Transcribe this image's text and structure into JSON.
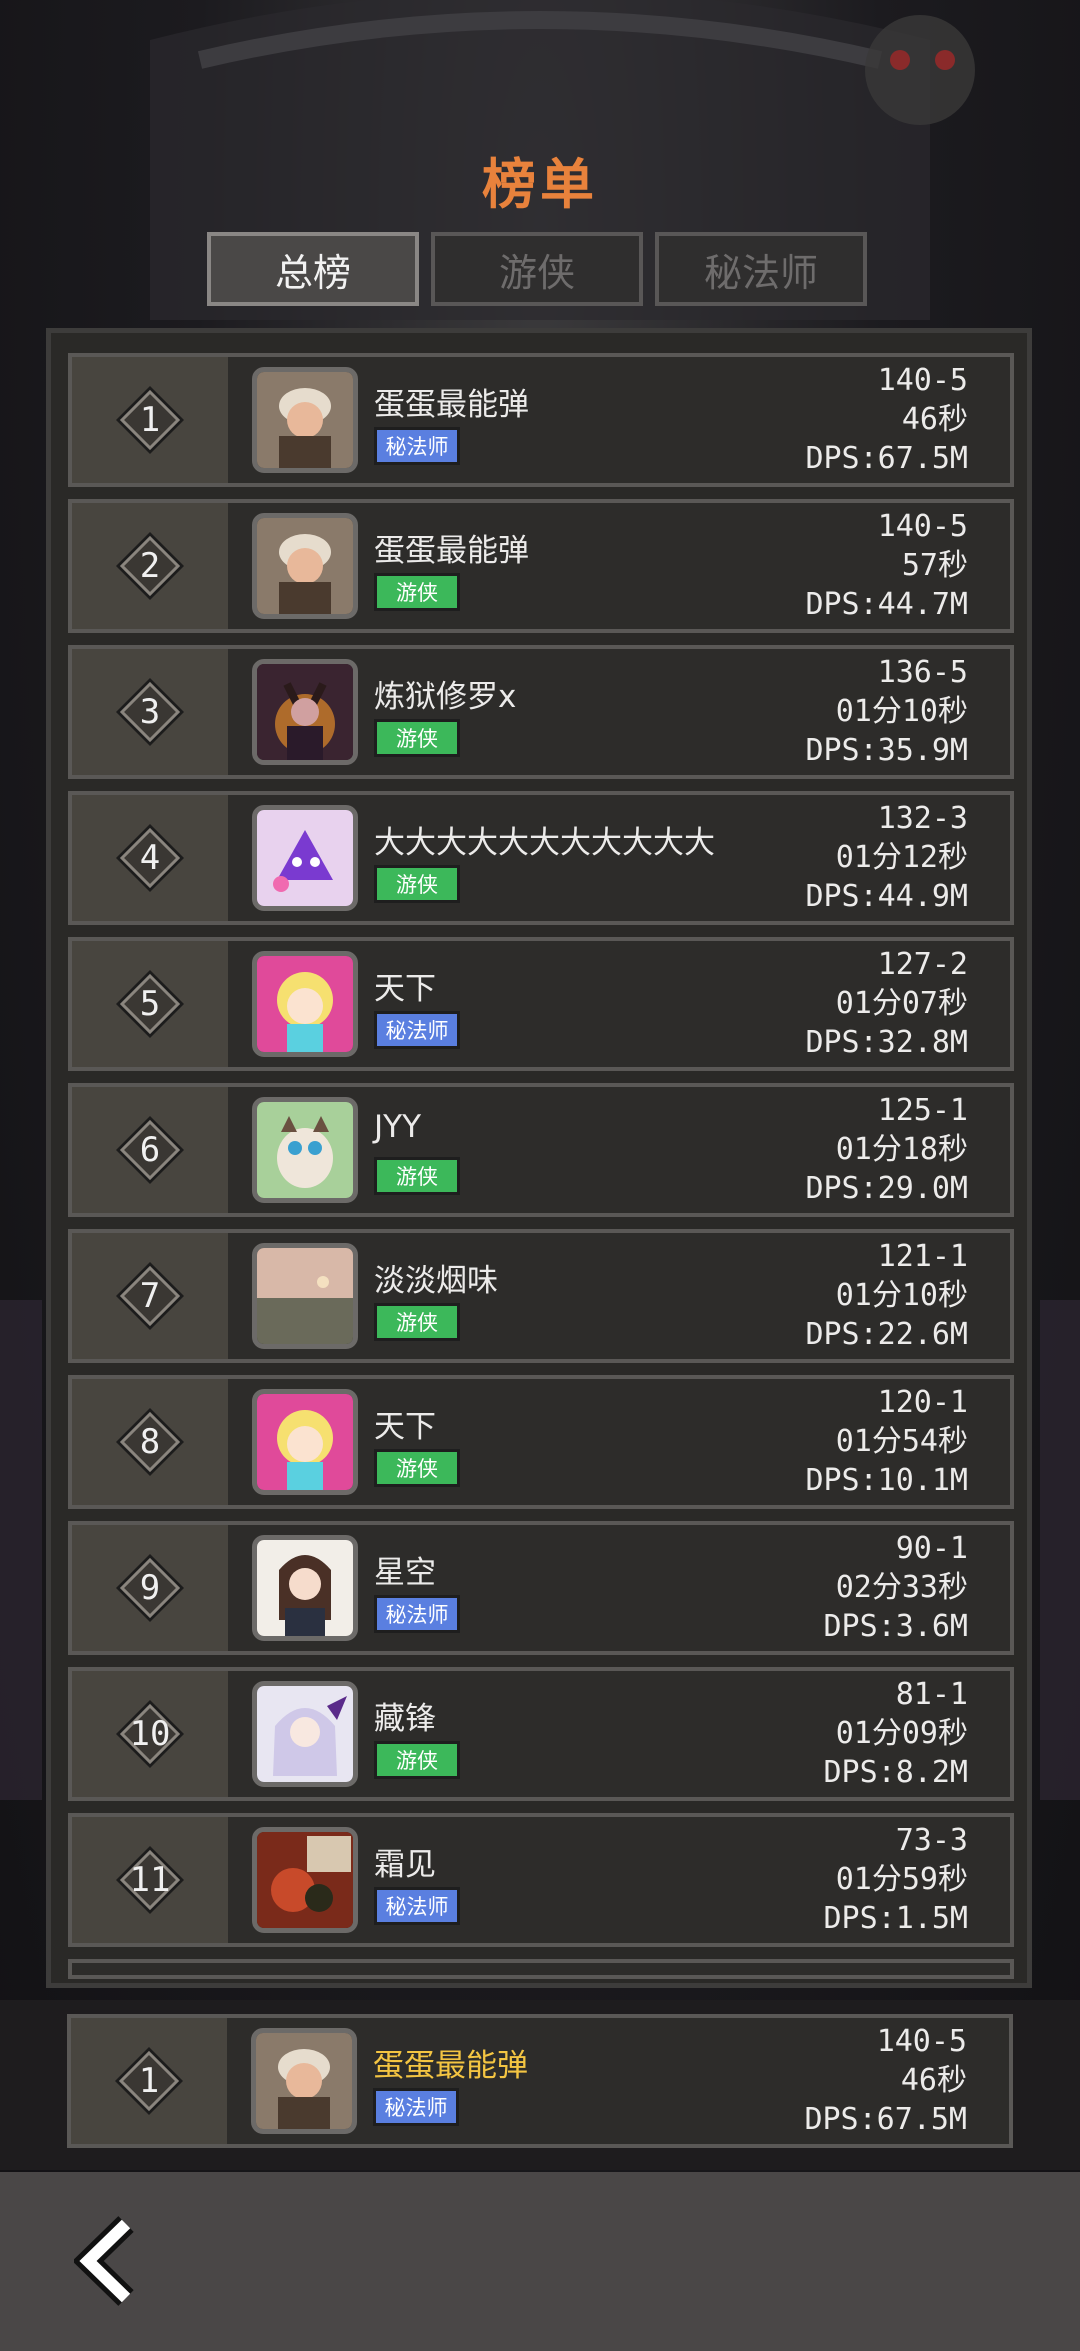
{
  "title": "榜单",
  "tabs": [
    "总榜",
    "游侠",
    "秘法师"
  ],
  "active_tab": 0,
  "colors": {
    "title": "#e8823c",
    "mage_badge": "#5a7fe0",
    "ranger_badge": "#3cb85a",
    "highlight_name": "#f4c542"
  },
  "entries": [
    {
      "rank": "1",
      "name": "蛋蛋最能弹",
      "class": "秘法师",
      "class_type": "mage",
      "stage": "140-5",
      "time": "46秒",
      "dps": "DPS:67.5M",
      "avatar": "baby-photo-avatar"
    },
    {
      "rank": "2",
      "name": "蛋蛋最能弹",
      "class": "游侠",
      "class_type": "ranger",
      "stage": "140-5",
      "time": "57秒",
      "dps": "DPS:44.7M",
      "avatar": "baby-photo-avatar"
    },
    {
      "rank": "3",
      "name": "炼狱修罗x",
      "class": "游侠",
      "class_type": "ranger",
      "stage": "136-5",
      "time": "01分10秒",
      "dps": "DPS:35.9M",
      "avatar": "demon-avatar"
    },
    {
      "rank": "4",
      "name": "大大大大大大大大大大大",
      "class": "游侠",
      "class_type": "ranger",
      "stage": "132-3",
      "time": "01分12秒",
      "dps": "DPS:44.9M",
      "avatar": "purple-creature-avatar"
    },
    {
      "rank": "5",
      "name": "天下",
      "class": "秘法师",
      "class_type": "mage",
      "stage": "127-2",
      "time": "01分07秒",
      "dps": "DPS:32.8M",
      "avatar": "cartoon-girl-avatar"
    },
    {
      "rank": "6",
      "name": "JYY",
      "class": "游侠",
      "class_type": "ranger",
      "stage": "125-1",
      "time": "01分18秒",
      "dps": "DPS:29.0M",
      "avatar": "cat-avatar"
    },
    {
      "rank": "7",
      "name": "淡淡烟味",
      "class": "游侠",
      "class_type": "ranger",
      "stage": "121-1",
      "time": "01分10秒",
      "dps": "DPS:22.6M",
      "avatar": "sunset-avatar"
    },
    {
      "rank": "8",
      "name": "天下",
      "class": "游侠",
      "class_type": "ranger",
      "stage": "120-1",
      "time": "01分54秒",
      "dps": "DPS:10.1M",
      "avatar": "cartoon-girl-avatar"
    },
    {
      "rank": "9",
      "name": "星空",
      "class": "秘法师",
      "class_type": "mage",
      "stage": "90-1",
      "time": "02分33秒",
      "dps": "DPS:3.6M",
      "avatar": "anime-girl-avatar"
    },
    {
      "rank": "10",
      "name": "藏锋",
      "class": "游侠",
      "class_type": "ranger",
      "stage": "81-1",
      "time": "01分09秒",
      "dps": "DPS:8.2M",
      "avatar": "silver-hair-avatar"
    },
    {
      "rank": "11",
      "name": "霜见",
      "class": "秘法师",
      "class_type": "mage",
      "stage": "73-3",
      "time": "01分59秒",
      "dps": "DPS:1.5M",
      "avatar": "miss-art-avatar"
    }
  ],
  "my_entry": {
    "rank": "1",
    "name": "蛋蛋最能弹",
    "class": "秘法师",
    "class_type": "mage",
    "stage": "140-5",
    "time": "46秒",
    "dps": "DPS:67.5M",
    "avatar": "baby-photo-avatar"
  },
  "back_icon": "back-arrow-icon"
}
